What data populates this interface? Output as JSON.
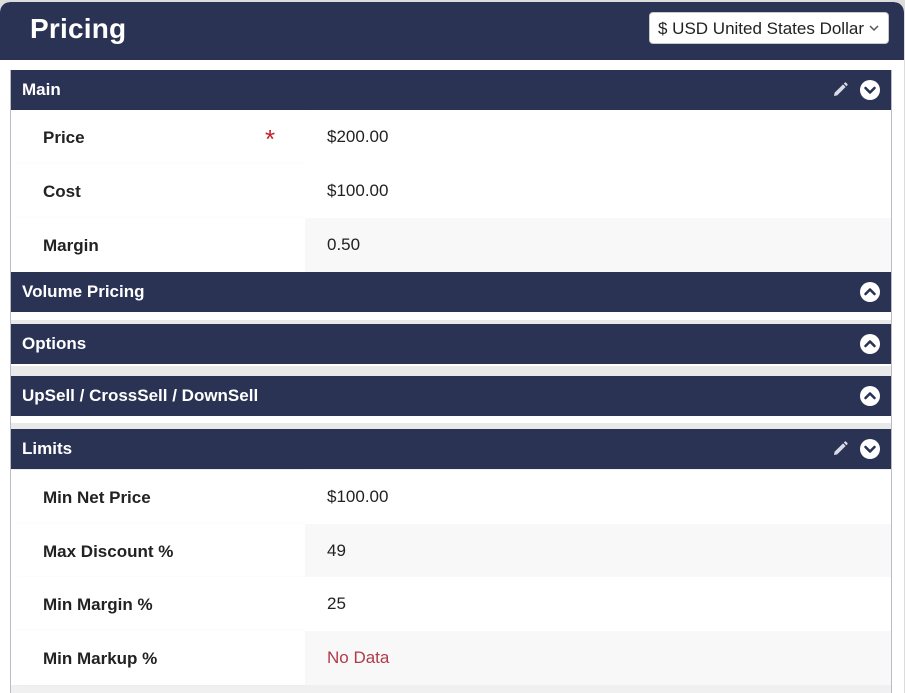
{
  "header": {
    "title": "Pricing",
    "currency_selected": "$ USD United States Dollar"
  },
  "colors": {
    "header_bg": "#2b3354",
    "required": "#c2202a",
    "no_data": "#b03a4a"
  },
  "sections": {
    "main": {
      "title": "Main",
      "rows": [
        {
          "label": "Price",
          "value": "$200.00",
          "required": true
        },
        {
          "label": "Cost",
          "value": "$100.00"
        },
        {
          "label": "Margin",
          "value": "0.50"
        }
      ]
    },
    "volume_pricing": {
      "title": "Volume Pricing"
    },
    "options": {
      "title": "Options"
    },
    "upsell": {
      "title": "UpSell / CrossSell / DownSell"
    },
    "limits": {
      "title": "Limits",
      "rows": [
        {
          "label": "Min Net Price",
          "value": "$100.00"
        },
        {
          "label": "Max Discount %",
          "value": "49"
        },
        {
          "label": "Min Margin %",
          "value": "25"
        },
        {
          "label": "Min Markup %",
          "value": "No Data"
        }
      ]
    }
  },
  "icons": {
    "required": "asterisk",
    "edit": "pencil-icon",
    "expand": "chevron-down-circle-icon",
    "collapse": "chevron-up-circle-icon",
    "select": "chevron-down-icon"
  }
}
